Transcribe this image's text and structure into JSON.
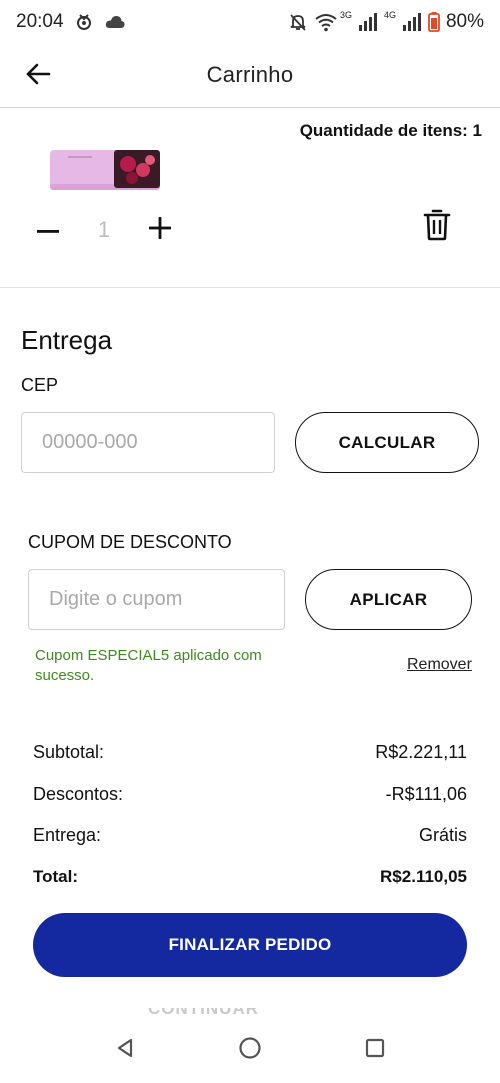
{
  "status_bar": {
    "time": "20:04",
    "battery": "80%",
    "network_1": "3G",
    "network_2": "4G"
  },
  "app_bar": {
    "title": "Carrinho"
  },
  "cart": {
    "items_count_label": "Quantidade de itens: 1",
    "quantity": "1"
  },
  "delivery": {
    "title": "Entrega",
    "cep_label": "CEP",
    "cep_placeholder": "00000-000",
    "calculate_label": "CALCULAR"
  },
  "coupon": {
    "label": "CUPOM DE DESCONTO",
    "placeholder": "Digite o cupom",
    "apply_label": "APLICAR",
    "success_message": "Cupom ESPECIAL5 aplicado com sucesso.",
    "remove_label": "Remover"
  },
  "summary": {
    "subtotal_label": "Subtotal:",
    "subtotal_value": "R$2.221,11",
    "discount_label": "Descontos:",
    "discount_value": "-R$111,06",
    "delivery_label": "Entrega:",
    "delivery_value": "Grátis",
    "total_label": "Total:",
    "total_value": "R$2.110,05"
  },
  "actions": {
    "finalize_label": "FINALIZAR PEDIDO",
    "continue_shopping_label": "CONTINUAR COMPRANDO"
  },
  "colors": {
    "primary": "#1428a0",
    "success": "#3d8a1f"
  },
  "icons": [
    "back-arrow-icon",
    "minus-icon",
    "plus-icon",
    "trash-icon",
    "nav-back-icon",
    "nav-home-icon",
    "nav-recents-icon"
  ]
}
